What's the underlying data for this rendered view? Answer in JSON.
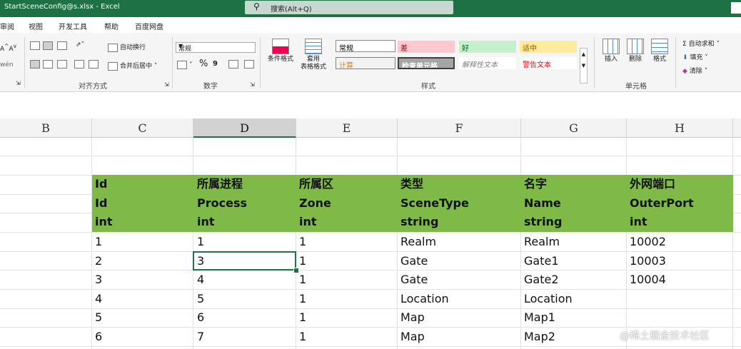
{
  "window": {
    "title": "StartSceneConfig@s.xlsx  -  Excel"
  },
  "search": {
    "icon": "search-icon",
    "label": "搜索(Alt+Q)"
  },
  "menu": {
    "items": [
      "审阅",
      "视图",
      "开发工具",
      "帮助",
      "百度网盘"
    ]
  },
  "ribbon": {
    "alignment": {
      "wrap_text": "自动换行",
      "merge_center": "合并后居中",
      "group_label": "对齐方式"
    },
    "number": {
      "format_value": "常规",
      "percent": "%",
      "group_label": "数字"
    },
    "styles": {
      "conditional_format": "条件格式",
      "table_format_line1": "套用",
      "table_format_line2": "表格格式",
      "cells": [
        {
          "label": "常规",
          "bg": "#ffffff",
          "color": "#000000"
        },
        {
          "label": "差",
          "bg": "#ffc7ce",
          "color": "#9c0006"
        },
        {
          "label": "好",
          "bg": "#c6efce",
          "color": "#006100"
        },
        {
          "label": "适中",
          "bg": "#ffeb9c",
          "color": "#9c5700"
        },
        {
          "label": "计算",
          "bg": "#f2f2f2",
          "color": "#fa7d00"
        },
        {
          "label": "检查单元格",
          "bg": "#a5a5a5",
          "color": "#ffffff"
        },
        {
          "label": "解释性文本",
          "bg": "#ffffff",
          "color": "#7f7f7f"
        },
        {
          "label": "警告文本",
          "bg": "#ffffff",
          "color": "#ff0000"
        }
      ],
      "group_label": "样式"
    },
    "cells_group": {
      "insert": "插入",
      "delete": "删除",
      "format": "格式",
      "group_label": "单元格"
    },
    "editing": {
      "autosum": "自动求和",
      "fill": "填充",
      "clear": "清除"
    }
  },
  "columns": [
    "B",
    "C",
    "D",
    "E",
    "F",
    "G",
    "H"
  ],
  "active_column": "D",
  "header_rows": [
    [
      "Id",
      "所属进程",
      "所属区",
      "类型",
      "名字",
      "外网端口"
    ],
    [
      "Id",
      "Process",
      "Zone",
      "SceneType",
      "Name",
      "OuterPort"
    ],
    [
      "int",
      "int",
      "int",
      "string",
      "string",
      "int"
    ]
  ],
  "data_rows": [
    [
      "1",
      "1",
      "1",
      "Realm",
      "Realm",
      "10002"
    ],
    [
      "2",
      "3",
      "1",
      "Gate",
      "Gate1",
      "10003"
    ],
    [
      "3",
      "4",
      "1",
      "Gate",
      "Gate2",
      "10004"
    ],
    [
      "4",
      "5",
      "1",
      "Location",
      "Location",
      ""
    ],
    [
      "5",
      "6",
      "1",
      "Map",
      "Map1",
      ""
    ],
    [
      "6",
      "7",
      "1",
      "Map",
      "Map2",
      ""
    ]
  ],
  "header_fill": "#7fba48",
  "watermark": "@稀土掘金技术社区"
}
